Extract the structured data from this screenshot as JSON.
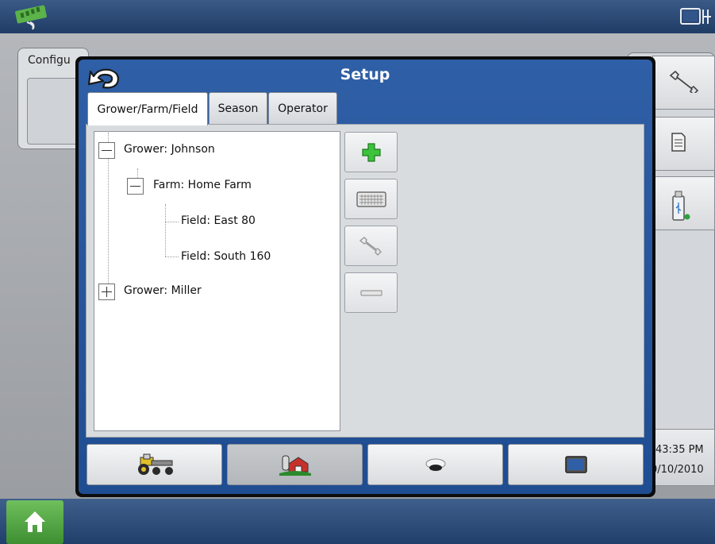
{
  "workspace": {
    "config_label": "Configu",
    "status_time": "43:35 PM",
    "status_date": "0/10/2010"
  },
  "dialog": {
    "title": "Setup",
    "tabs": [
      {
        "label": "Grower/Farm/Field",
        "active": true
      },
      {
        "label": "Season",
        "active": false
      },
      {
        "label": "Operator",
        "active": false
      }
    ],
    "tree": [
      {
        "label": "Grower: Johnson",
        "expander": "minus"
      },
      {
        "label": "Farm: Home Farm",
        "expander": "minus"
      },
      {
        "label": "Field: East 80",
        "expander": "none"
      },
      {
        "label": "Field: South 160",
        "expander": "none"
      },
      {
        "label": "Grower: Miller",
        "expander": "plus"
      }
    ],
    "actions": [
      {
        "icon": "add-icon"
      },
      {
        "icon": "keyboard-icon"
      },
      {
        "icon": "wrench-icon"
      },
      {
        "icon": "minus-icon"
      }
    ],
    "bottom_nav": [
      {
        "icon": "tractor-icon",
        "selected": false
      },
      {
        "icon": "farm-icon",
        "selected": true
      },
      {
        "icon": "receiver-icon",
        "selected": false
      },
      {
        "icon": "display-icon",
        "selected": false
      }
    ]
  },
  "right_buttons": [
    {
      "icon": "wrench-icon"
    },
    {
      "icon": "document-icon"
    },
    {
      "icon": "usb-icon"
    }
  ],
  "colors": {
    "header_blue": "#2f5fa6",
    "add_green": "#3cc23c",
    "home_green": "#4aa43a"
  }
}
